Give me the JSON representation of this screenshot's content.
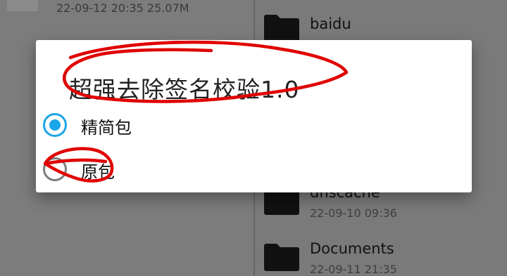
{
  "background_list": {
    "left_item": {
      "meta": "22-09-12 20:35  25.07M"
    },
    "right_items": [
      {
        "name": "baidu",
        "meta": ""
      },
      {
        "name": "dnscache",
        "meta": "22-09-10 09:36"
      },
      {
        "name": "Documents",
        "meta": "22-09-11 21:35"
      }
    ]
  },
  "dialog": {
    "title": "超强去除签名校验1.0",
    "options": [
      {
        "label": "精简包",
        "selected": true
      },
      {
        "label": "原包",
        "selected": false
      }
    ]
  },
  "colors": {
    "accent": "#1aa6e8",
    "annotation": "#e00000",
    "scrim": "#7b7b7b"
  }
}
